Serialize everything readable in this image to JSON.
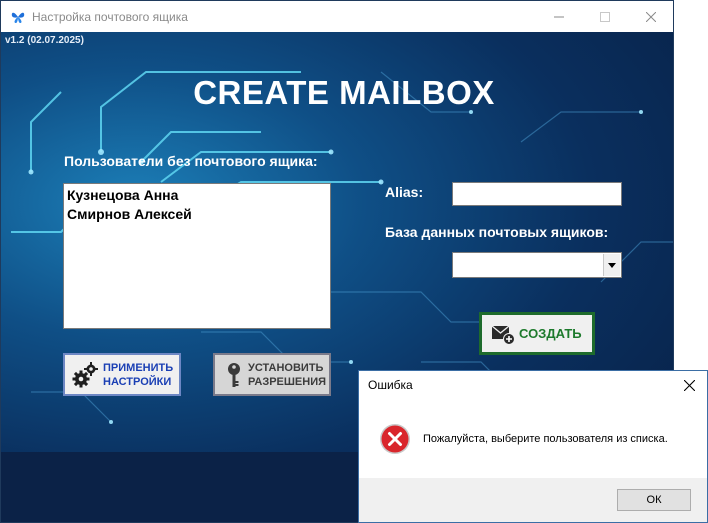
{
  "window": {
    "title": "Настройка почтового ящика",
    "version": "v1.2 (02.07.2025)",
    "icon": "app-butterfly-icon",
    "controls": {
      "minimize": "minimize-icon",
      "maximize": "maximize-icon",
      "close": "close-icon"
    }
  },
  "main": {
    "heading": "CREATE MAILBOX",
    "users_label": "Пользователи без почтового ящика:",
    "users": [
      "Кузнецова Анна",
      "Смирнов Алексей"
    ],
    "alias_label": "Alias:",
    "alias_value": "",
    "db_label": "База данных почтовых ящиков:",
    "db_value": "",
    "create_button": "СОЗДАТЬ",
    "apply_button": {
      "line1": "ПРИМЕНИТЬ",
      "line2": "НАСТРОЙКИ"
    },
    "permissions_button": {
      "line1": "УСТАНОВИТЬ",
      "line2": "РАЗРЕШЕНИЯ"
    }
  },
  "dialog": {
    "title": "Ошибка",
    "message": "Пожалуйста, выберите пользователя из списка.",
    "ok_button": "ОК",
    "icon": "error-icon"
  },
  "colors": {
    "create_accent": "#1d7a2c",
    "apply_text": "#1a3fb4",
    "error_red": "#d9262c"
  }
}
